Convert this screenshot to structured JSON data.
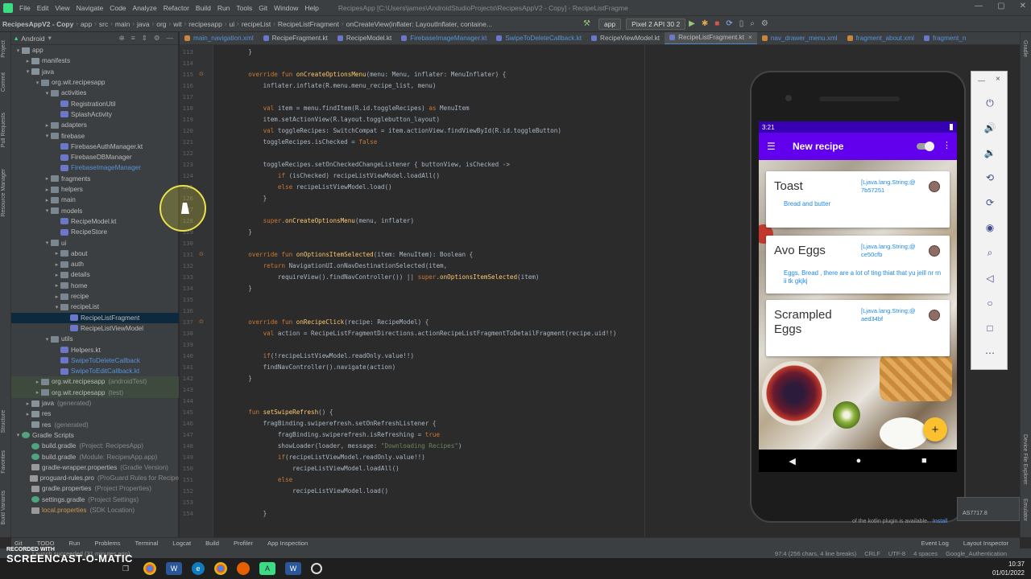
{
  "menubar": {
    "items": [
      "File",
      "Edit",
      "View",
      "Navigate",
      "Code",
      "Analyze",
      "Refactor",
      "Build",
      "Run",
      "Tools",
      "Git",
      "Window",
      "Help"
    ],
    "window_title": "RecipesApp [C:\\Users\\james\\AndroidStudioProjects\\RecipesAppV2 - Copy] - RecipeListFragment.kt [RecipesApp.app]"
  },
  "toolbar": {
    "breadcrumbs": [
      "RecipesAppV2 - Copy",
      "app",
      "src",
      "main",
      "java",
      "org",
      "wit",
      "recipesapp",
      "ui",
      "recipeList",
      "RecipeListFragment",
      "onCreateView(inflater: LayoutInflater, containe..."
    ],
    "run_config": "app",
    "device": "Pixel 2 API 30 2"
  },
  "project_panel": {
    "mode": "Android",
    "rows": [
      {
        "depth": 0,
        "arrow": "▾",
        "icon": "folder",
        "label": "app",
        "note": ""
      },
      {
        "depth": 1,
        "arrow": "▸",
        "icon": "folder",
        "label": "manifests",
        "note": ""
      },
      {
        "depth": 1,
        "arrow": "▾",
        "icon": "folder",
        "label": "java",
        "note": ""
      },
      {
        "depth": 2,
        "arrow": "▾",
        "icon": "pkg",
        "label": "org.wit.recipesapp",
        "note": ""
      },
      {
        "depth": 3,
        "arrow": "▾",
        "icon": "pkg",
        "label": "activities",
        "note": ""
      },
      {
        "depth": 4,
        "arrow": "",
        "icon": "kt",
        "label": "RegistrationUtil",
        "note": ""
      },
      {
        "depth": 4,
        "arrow": "",
        "icon": "kt",
        "label": "SplashActivity",
        "note": ""
      },
      {
        "depth": 3,
        "arrow": "▸",
        "icon": "pkg",
        "label": "adapters",
        "note": ""
      },
      {
        "depth": 3,
        "arrow": "▾",
        "icon": "pkg",
        "label": "firebase",
        "note": ""
      },
      {
        "depth": 4,
        "arrow": "",
        "icon": "kt",
        "label": "FirebaseAuthManager.kt",
        "note": ""
      },
      {
        "depth": 4,
        "arrow": "",
        "icon": "kt",
        "label": "FirebaseDBManager",
        "note": ""
      },
      {
        "depth": 4,
        "arrow": "",
        "icon": "kt",
        "label": "FirebaseImageManager",
        "note": "",
        "style": "blue"
      },
      {
        "depth": 3,
        "arrow": "▸",
        "icon": "pkg",
        "label": "fragments",
        "note": ""
      },
      {
        "depth": 3,
        "arrow": "▸",
        "icon": "pkg",
        "label": "helpers",
        "note": ""
      },
      {
        "depth": 3,
        "arrow": "▸",
        "icon": "pkg",
        "label": "main",
        "note": ""
      },
      {
        "depth": 3,
        "arrow": "▾",
        "icon": "pkg",
        "label": "models",
        "note": ""
      },
      {
        "depth": 4,
        "arrow": "",
        "icon": "kt",
        "label": "RecipeModel.kt",
        "note": ""
      },
      {
        "depth": 4,
        "arrow": "",
        "icon": "kt",
        "label": "RecipeStore",
        "note": ""
      },
      {
        "depth": 3,
        "arrow": "▾",
        "icon": "pkg",
        "label": "ui",
        "note": ""
      },
      {
        "depth": 4,
        "arrow": "▸",
        "icon": "pkg",
        "label": "about",
        "note": ""
      },
      {
        "depth": 4,
        "arrow": "▸",
        "icon": "pkg",
        "label": "auth",
        "note": ""
      },
      {
        "depth": 4,
        "arrow": "▸",
        "icon": "pkg",
        "label": "details",
        "note": ""
      },
      {
        "depth": 4,
        "arrow": "▸",
        "icon": "pkg",
        "label": "home",
        "note": ""
      },
      {
        "depth": 4,
        "arrow": "▸",
        "icon": "pkg",
        "label": "recipe",
        "note": ""
      },
      {
        "depth": 4,
        "arrow": "▾",
        "icon": "pkg",
        "label": "recipeList",
        "note": ""
      },
      {
        "depth": 5,
        "arrow": "",
        "icon": "kt",
        "label": "RecipeListFragment",
        "note": "",
        "style": "sel"
      },
      {
        "depth": 5,
        "arrow": "",
        "icon": "kt",
        "label": "RecipeListViewModel",
        "note": ""
      },
      {
        "depth": 3,
        "arrow": "▾",
        "icon": "pkg",
        "label": "utils",
        "note": ""
      },
      {
        "depth": 4,
        "arrow": "",
        "icon": "kt",
        "label": "Helpers.kt",
        "note": ""
      },
      {
        "depth": 4,
        "arrow": "",
        "icon": "kt",
        "label": "SwipeToDeleteCallback",
        "note": "",
        "style": "blue"
      },
      {
        "depth": 4,
        "arrow": "",
        "icon": "kt",
        "label": "SwipeToEditCallback.kt",
        "note": "",
        "style": "blue"
      },
      {
        "depth": 2,
        "arrow": "▸",
        "icon": "pkg",
        "label": "org.wit.recipesapp",
        "note": "(androidTest)",
        "style": "hl"
      },
      {
        "depth": 2,
        "arrow": "▸",
        "icon": "pkg",
        "label": "org.wit.recipesapp",
        "note": "(test)",
        "style": "hl"
      },
      {
        "depth": 1,
        "arrow": "▸",
        "icon": "folder",
        "label": "java",
        "note": "(generated)"
      },
      {
        "depth": 1,
        "arrow": "▸",
        "icon": "folder",
        "label": "res",
        "note": ""
      },
      {
        "depth": 1,
        "arrow": "",
        "icon": "folder",
        "label": "res",
        "note": "(generated)"
      },
      {
        "depth": 0,
        "arrow": "▾",
        "icon": "gradle",
        "label": "Gradle Scripts",
        "note": ""
      },
      {
        "depth": 1,
        "arrow": "",
        "icon": "gradle",
        "label": "build.gradle",
        "note": "(Project: RecipesApp)"
      },
      {
        "depth": 1,
        "arrow": "",
        "icon": "gradle",
        "label": "build.gradle",
        "note": "(Module: RecipesApp.app)"
      },
      {
        "depth": 1,
        "arrow": "",
        "icon": "props",
        "label": "gradle-wrapper.properties",
        "note": "(Gradle Version)"
      },
      {
        "depth": 1,
        "arrow": "",
        "icon": "props",
        "label": "proguard-rules.pro",
        "note": "(ProGuard Rules for Recipe"
      },
      {
        "depth": 1,
        "arrow": "",
        "icon": "props",
        "label": "gradle.properties",
        "note": "(Project Properties)"
      },
      {
        "depth": 1,
        "arrow": "",
        "icon": "gradle",
        "label": "settings.gradle",
        "note": "(Project Settings)"
      },
      {
        "depth": 1,
        "arrow": "",
        "icon": "props",
        "label": "local.properties",
        "note": "(SDK Location)",
        "style": "orange"
      }
    ]
  },
  "left_strip_tabs": [
    "Project",
    "Commit",
    "Pull Requests",
    "Resource Manager",
    "Structure",
    "Favorites",
    "Build Variants"
  ],
  "right_strip_tabs": [
    "Gradle",
    "Device File Explorer",
    "Emulator"
  ],
  "editor_tabs": [
    {
      "label": "main_navigation.xml",
      "active": false,
      "style": "blue"
    },
    {
      "label": "RecipeFragment.kt",
      "active": false
    },
    {
      "label": "RecipeModel.kt",
      "active": false
    },
    {
      "label": "FirebaseImageManager.kt",
      "active": false,
      "style": "blue"
    },
    {
      "label": "SwipeToDeleteCallback.kt",
      "active": false,
      "style": "blue"
    },
    {
      "label": "RecipeViewModel.kt",
      "active": false
    },
    {
      "label": "RecipeListFragment.kt",
      "active": true
    },
    {
      "label": "nav_drawer_menu.xml",
      "active": false,
      "style": "blue"
    },
    {
      "label": "fragment_about.xml",
      "active": false,
      "style": "blue"
    },
    {
      "label": "fragment_n",
      "active": false,
      "style": "blue"
    }
  ],
  "editor": {
    "warning_count": "1",
    "line_numbers": [
      "113",
      "114",
      "115",
      "116",
      "117",
      "118",
      "119",
      "120",
      "121",
      "122",
      "123",
      "124",
      "125",
      "126",
      "127",
      "128",
      "129",
      "130",
      "131",
      "132",
      "133",
      "134",
      "135",
      "136",
      "137",
      "138",
      "139",
      "140",
      "141",
      "142",
      "143",
      "144",
      "145",
      "146",
      "147",
      "148",
      "149",
      "150",
      "151",
      "152",
      "153",
      "154"
    ],
    "lines": [
      "    }",
      "",
      "    override fun onCreateOptionsMenu(menu: Menu, inflater: MenuInflater) {",
      "        inflater.inflate(R.menu.menu_recipe_list, menu)",
      "",
      "        val item = menu.findItem(R.id.toggleRecipes) as MenuItem",
      "        item.setActionView(R.layout.togglebutton_layout)",
      "        val toggleRecipes: SwitchCompat = item.actionView.findViewById(R.id.toggleButton)",
      "        toggleRecipes.isChecked = false",
      "",
      "        toggleRecipes.setOnCheckedChangeListener { buttonView, isChecked ->",
      "            if (isChecked) recipeListViewModel.loadAll()",
      "            else recipeListViewModel.load()",
      "        }",
      "",
      "        super.onCreateOptionsMenu(menu, inflater)",
      "    }",
      "",
      "    override fun onOptionsItemSelected(item: MenuItem): Boolean {",
      "        return NavigationUI.onNavDestinationSelected(item,",
      "            requireView().findNavController()) || super.onOptionsItemSelected(item)",
      "    }",
      "",
      "",
      "    override fun onRecipeClick(recipe: RecipeModel) {",
      "        val action = RecipeListFragmentDirections.actionRecipeListFragmentToDetailFragment(recipe.uid!!)",
      "",
      "        if(!recipeListViewModel.readOnly.value!!)",
      "        findNavController().navigate(action)",
      "    }",
      "",
      "",
      "    fun setSwipeRefresh() {",
      "        fragBinding.swiperefresh.setOnRefreshListener {",
      "            fragBinding.swiperefresh.isRefreshing = true",
      "            showLoader(loader, message: \"Downloading Recipes\")",
      "            if(recipeListViewModel.readOnly.value!!)",
      "                recipeListViewModel.loadAll()",
      "            else",
      "                recipeListViewModel.load()",
      "",
      "        }"
    ]
  },
  "emulator": {
    "status_time": "3:21",
    "app_title": "New recipe",
    "recipes": [
      {
        "title": "Toast",
        "meta": "[Ljava.lang.String;@7b57251",
        "description": "Bread and butter"
      },
      {
        "title": "Avo Eggs",
        "meta": "[Ljava.lang.String;@ce50cfb",
        "description": "Eggs, Bread , there are a lot of ting thiat that yu jeill nr rn ii tk gkjkj"
      },
      {
        "title": "Scrampled Eggs",
        "meta": "[Ljava.lang.String;@aed34bf",
        "description": ""
      }
    ],
    "fab_label": "+",
    "side_close": "×"
  },
  "popup_text": {
    "version": "AS7717.8",
    "note": "of the kotlin plugin is available.",
    "link": "Install"
  },
  "bottom_tools": [
    "Git",
    "TODO",
    "Run",
    "Problems",
    "Terminal",
    "Logcat",
    "Build",
    "Profiler",
    "App Inspection"
  ],
  "bottom_tools_right": [
    "Event Log",
    "Layout Inspector"
  ],
  "status_bar": {
    "left": "Launch succeeded (31 minutes ago)",
    "position": "97:4 (256 chars, 4 line breaks)",
    "line_sep": "CRLF",
    "encoding": "UTF-8",
    "indent": "4 spaces",
    "branch": "Google_Authentication"
  },
  "watermark": {
    "line1": "RECORDED WITH",
    "line2": "SCREENCAST",
    "line3": "MATIC"
  },
  "clock": {
    "time": "10:37",
    "date": "01/01/2022"
  },
  "colors": {
    "accent": "#6200ee",
    "status": "#3700b3",
    "fab": "#fbc02d",
    "selection": "#0d293e"
  }
}
